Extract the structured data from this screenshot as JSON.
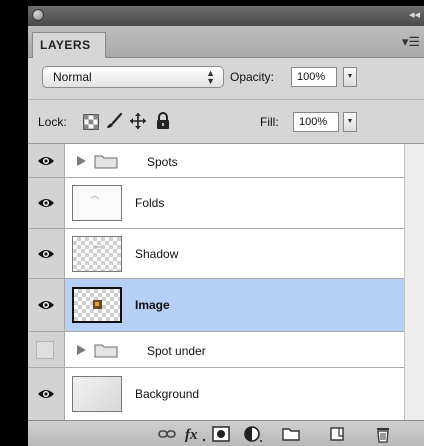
{
  "panel": {
    "tab_label": "LAYERS",
    "menu_icon": "panel-menu-icon",
    "collapse_icon": "collapse-icon"
  },
  "blend": {
    "mode": "Normal",
    "opacity_label": "Opacity:",
    "opacity_value": "100%"
  },
  "lock": {
    "label": "Lock:",
    "fill_label": "Fill:",
    "fill_value": "100%",
    "icons": [
      "lock-transparent-pixels-icon",
      "lock-image-pixels-icon",
      "lock-position-icon",
      "lock-all-icon"
    ]
  },
  "layers": [
    {
      "name": "Spots",
      "type": "group",
      "visible": true,
      "selected": false
    },
    {
      "name": "Folds",
      "type": "layer",
      "visible": true,
      "selected": false
    },
    {
      "name": "Shadow",
      "type": "layer",
      "visible": true,
      "selected": false
    },
    {
      "name": "Image",
      "type": "layer",
      "visible": true,
      "selected": true
    },
    {
      "name": "Spot under",
      "type": "group",
      "visible": false,
      "selected": false
    },
    {
      "name": "Background",
      "type": "layer",
      "visible": true,
      "selected": false
    }
  ],
  "colors": {
    "selected_row": "#b6cff4",
    "panel_bg": "#d6d6d6"
  },
  "bottom_icons": [
    "link-layers-icon",
    "fx-icon",
    "add-mask-icon",
    "adjustment-layer-icon",
    "new-group-icon",
    "new-layer-icon",
    "trash-icon"
  ]
}
